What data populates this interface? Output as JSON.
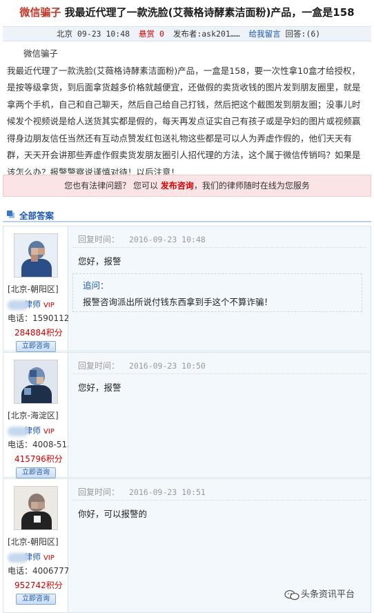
{
  "question": {
    "title_prefix": "微信骗子",
    "title_rest": " 我最近代理了一款洗脸(艾薇格诗酵素洁面粉)产品，一盒是158",
    "location_time": "北京 09-23 10:48",
    "reward": "悬赏 0",
    "poster": "发布者:ask201……",
    "leave_message": "给我留言",
    "answers_count": "回答:(6)",
    "subtitle": "微信骗子",
    "body": "我最近代理了一款洗脸(艾薇格诗酵素洁面粉)产品，一盒是158，要一次性拿10盒才给授权，是按等级拿货，到后面拿货越多价格就越便宜，还做假的卖货收钱的图片发到朋友圈里，就是拿两个手机，自己和自己聊天，然后自己给自己打钱，然后把这个截图发到朋友圈；没事儿时候发个视频说是给人送货其实都是假的，每天再发点证实自己有孩子或是孕妇的图片或视频赢得身边朋友信任当然还有互动点赞发红包送礼物这些都是可以人为弄虚作假的，他们天天有群，天天开会讲那些弄虚作假卖货发朋友圈引人招代理的方法，这个属于微信传销吗？如果是该怎么办？报警警察说谨慎对待！以后注意！"
  },
  "promo": {
    "prefix": "您也有法律问题？  您可以 ",
    "highlight": "发布咨询",
    "suffix": "，我们的律师随时在线为您服务"
  },
  "section": {
    "title": "全部答案"
  },
  "answers": [
    {
      "location": "[北京-朝阳区]",
      "lawyer_suffix": "律师",
      "vip": "VIP",
      "phone": "电话：1590112…",
      "points": "284884积分",
      "consult": "立即咨询",
      "reply_label": "回复时间：",
      "reply_time": "2016-09-23 10:48",
      "reply": "您好，报警",
      "followup_label": "追问：",
      "followup": "报警咨询派出所说付钱东西拿到手这个不算诈骗！"
    },
    {
      "location": "[北京-海淀区]",
      "lawyer_suffix": "律师",
      "vip": "VIP",
      "phone": "电话：4008-51…",
      "points": "415796积分",
      "consult": "立即咨询",
      "reply_label": "回复时间：",
      "reply_time": "2016-09-23 10:50",
      "reply": "您好，报警"
    },
    {
      "location": "[北京-朝阳区]",
      "lawyer_suffix": "律师",
      "vip": "VIP",
      "phone": "电话：4006777…",
      "points": "952742积分",
      "consult": "立即咨询",
      "reply_label": "回复时间：",
      "reply_time": "2016-09-23 10:51",
      "reply": "你好，可以报警的"
    }
  ],
  "watermark": {
    "text": "头条资讯平台"
  },
  "colors": {
    "link": "#1b55b5",
    "red": "#cc0000",
    "promo_bg": "#fbe4e6"
  }
}
